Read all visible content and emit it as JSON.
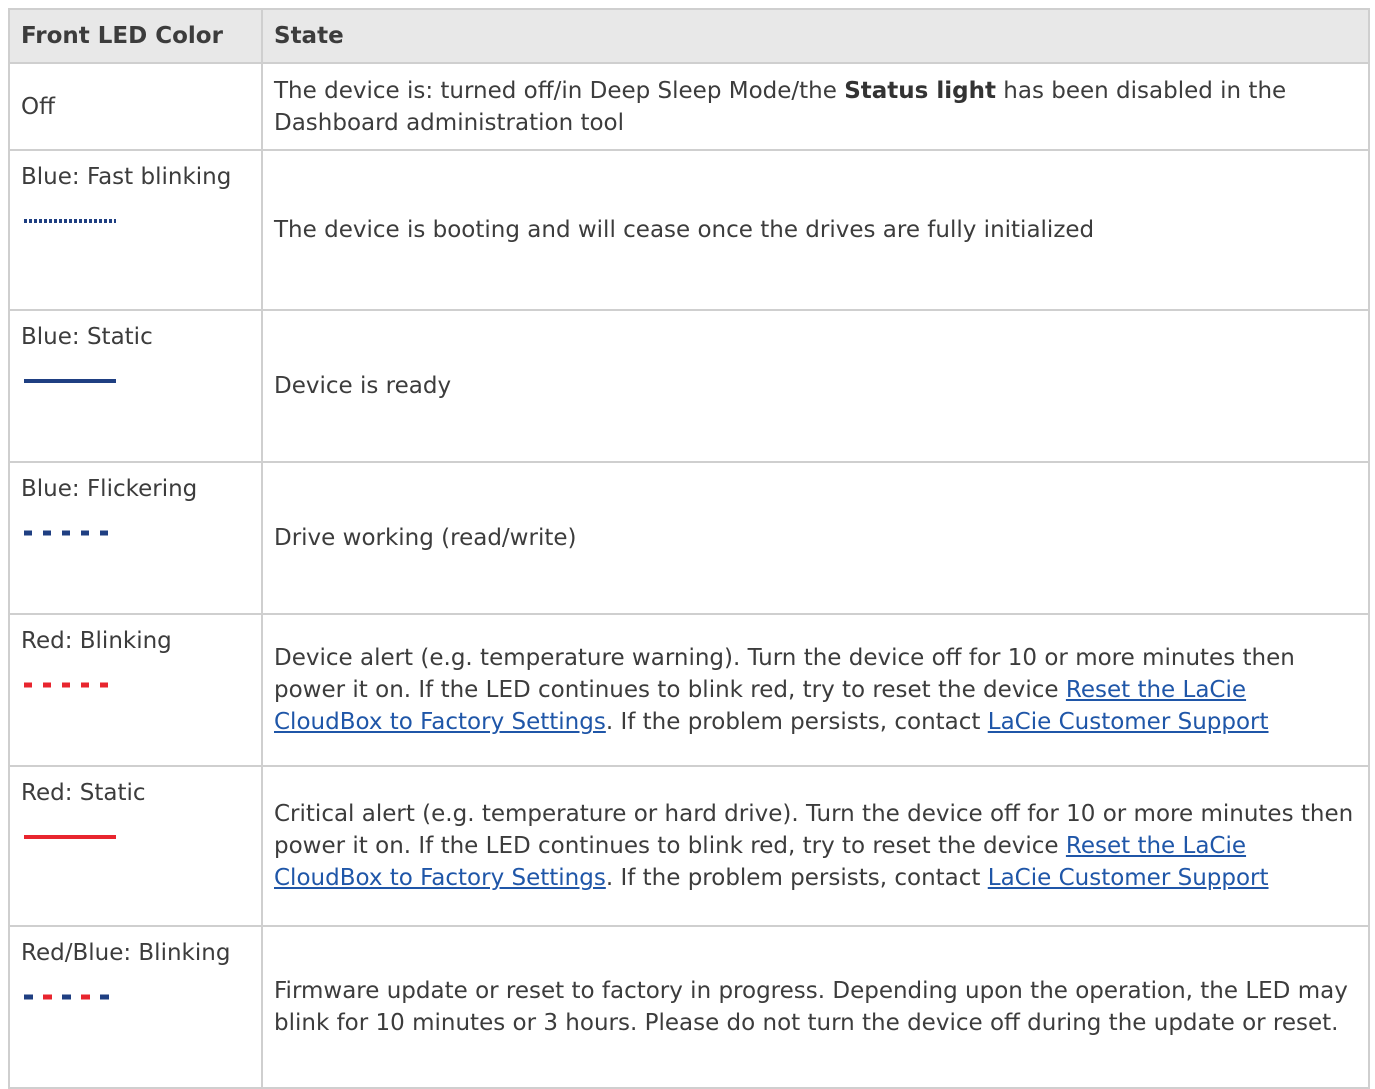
{
  "table": {
    "headers": [
      "Front LED Color",
      "State"
    ],
    "rows": [
      {
        "color": "Off",
        "state_parts": [
          "The device is: turned off/in Deep Sleep Mode/the ",
          "Status light",
          " has been disabled in the Dashboard administration tool"
        ]
      },
      {
        "color": "Blue: Fast blinking",
        "state": "The device is booting and will cease once the drives are fully initialized",
        "led_icon": "blue-fast-blinking-led-icon"
      },
      {
        "color": "Blue: Static",
        "state": "Device is ready",
        "led_icon": "blue-static-led-icon"
      },
      {
        "color": "Blue: Flickering",
        "state": "Drive working (read/write)",
        "led_icon": "blue-flickering-led-icon"
      },
      {
        "color": "Red: Blinking",
        "state_text": "Device alert (e.g. temperature warning). Turn the device off for 10 or more minutes then power it on. If the LED continues to blink red, try to reset the device ",
        "link1": "Reset the LaCie CloudBox to Factory Settings",
        "mid_text": ". If the problem persists, contact ",
        "link2": " LaCie Customer Support",
        "led_icon": "red-blinking-led-icon"
      },
      {
        "color": "Red: Static",
        "state_text": "Critical alert (e.g. temperature or hard drive). Turn the device off for 10 or more minutes then power it on. If the LED continues to blink red, try to reset the device ",
        "link1": "Reset the LaCie CloudBox to Factory Settings",
        "mid_text": ". If the problem persists, contact ",
        "link2": " LaCie Customer Support",
        "led_icon": "red-static-led-icon"
      },
      {
        "color": "Red/Blue: Blinking",
        "state": "Firmware update or reset to factory in progress. Depending upon the operation, the LED may blink for 10 minutes or 3 hours. Please do not turn the device off during the update or reset.",
        "led_icon": "red-blue-blinking-led-icon"
      }
    ]
  },
  "colors": {
    "blue": "#1f3f82",
    "red": "#e8252e",
    "link": "#1f56a8",
    "header_bg": "#e8e8e8",
    "border": "#cfcfcf"
  }
}
